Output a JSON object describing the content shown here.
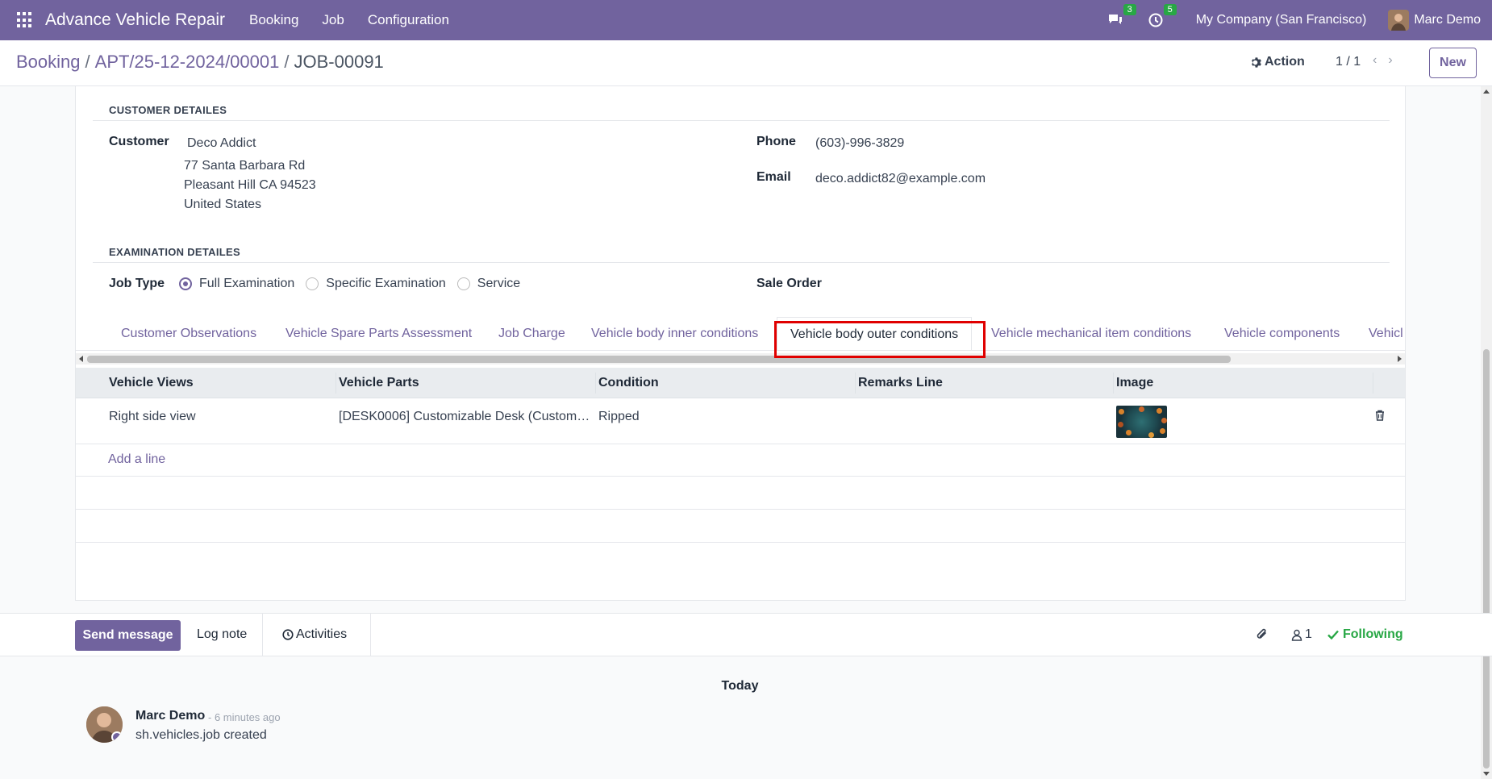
{
  "navbar": {
    "brand": "Advance Vehicle Repair",
    "menu": [
      "Booking",
      "Job",
      "Configuration"
    ],
    "messages_count": "3",
    "activities_count": "5",
    "company": "My Company (San Francisco)",
    "user": "Marc Demo"
  },
  "control_panel": {
    "breadcrumb": [
      "Booking",
      "APT/25-12-2024/00001",
      "JOB-00091"
    ],
    "action_label": "Action",
    "pager": "1 / 1",
    "new_label": "New"
  },
  "customer": {
    "section_title": "CUSTOMER DETAILES",
    "customer_label": "Customer",
    "customer_name": "Deco Addict",
    "address_line1": "77 Santa Barbara Rd",
    "address_line2": "Pleasant Hill CA 94523",
    "address_line3": "United States",
    "phone_label": "Phone",
    "phone": "(603)-996-3829",
    "email_label": "Email",
    "email": "deco.addict82@example.com"
  },
  "examination": {
    "section_title": "EXAMINATION DETAILES",
    "job_type_label": "Job Type",
    "options": [
      "Full Examination",
      "Specific Examination",
      "Service"
    ],
    "selected": "Full Examination",
    "sale_order_label": "Sale Order"
  },
  "tabs": [
    "Customer Observations",
    "Vehicle Spare Parts Assessment",
    "Job Charge",
    "Vehicle body inner conditions",
    "Vehicle body outer conditions",
    "Vehicle mechanical item conditions",
    "Vehicle components",
    "Vehicl"
  ],
  "active_tab": "Vehicle body outer conditions",
  "table": {
    "headers": [
      "Vehicle Views",
      "Vehicle Parts",
      "Condition",
      "Remarks Line",
      "Image"
    ],
    "rows": [
      {
        "view": "Right side view",
        "part": "[DESK0006] Customizable Desk (Custom…",
        "condition": "Ripped",
        "remarks": ""
      }
    ],
    "add_line": "Add a line"
  },
  "chatter": {
    "send_message": "Send message",
    "log_note": "Log note",
    "activities": "Activities",
    "followers_count": "1",
    "following": "Following",
    "day_separator": "Today",
    "messages": [
      {
        "author": "Marc Demo",
        "time": "- 6 minutes ago",
        "body": "sh.vehicles.job created"
      }
    ]
  },
  "colors": {
    "brand": "#71639e",
    "highlight": "#e00000",
    "following": "#28a745"
  }
}
